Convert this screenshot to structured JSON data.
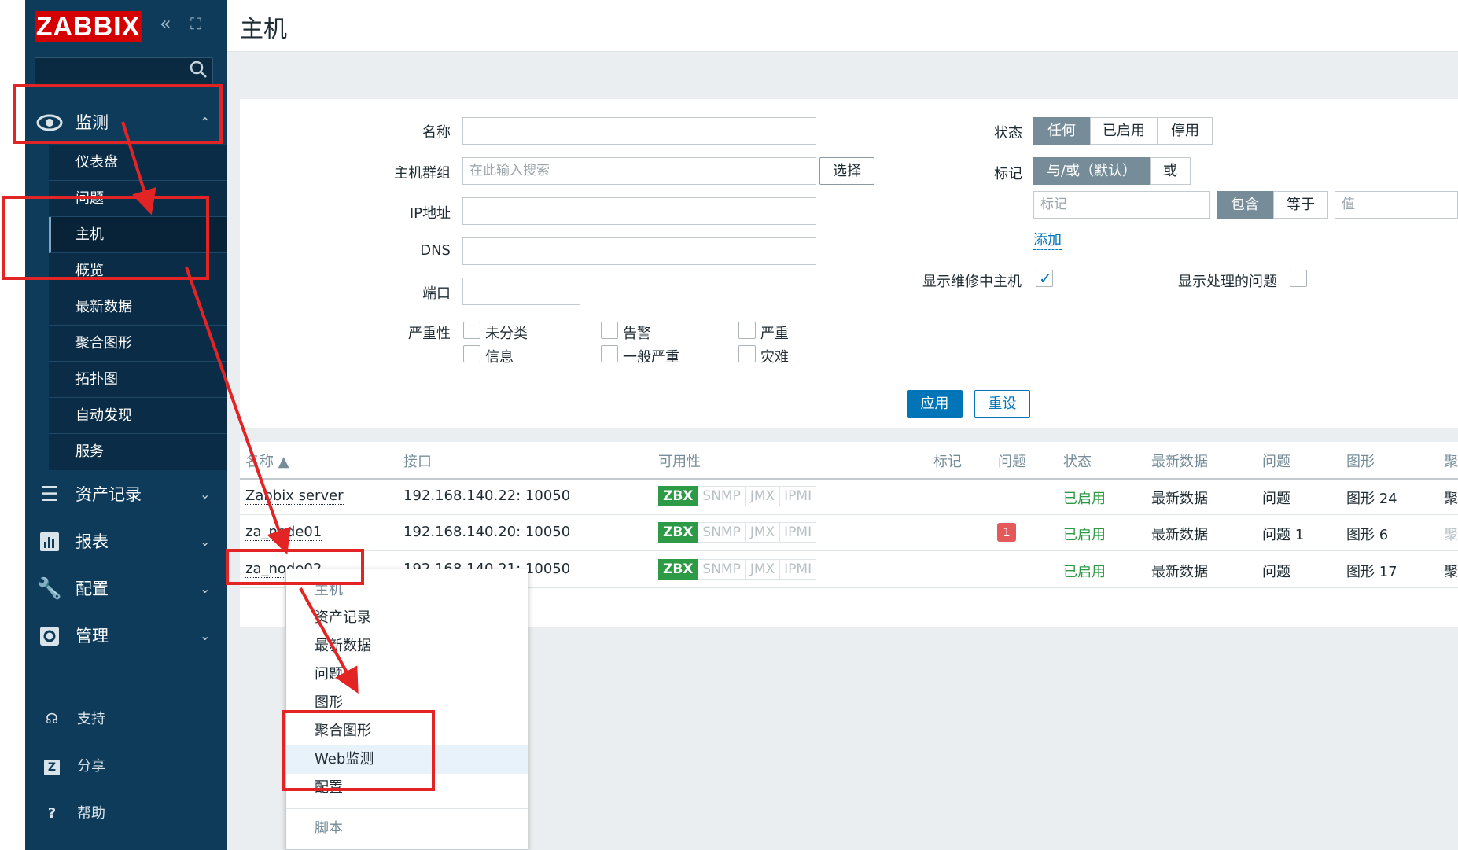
{
  "sidebar": {
    "logo": "ZABBIX",
    "collapse_icon": "«",
    "kiosk_icon": "⛶",
    "monitoring": {
      "label": "监测",
      "items": [
        "仪表盘",
        "问题",
        "主机",
        "概览",
        "最新数据",
        "聚合图形",
        "拓扑图",
        "自动发现",
        "服务"
      ]
    },
    "sections": [
      "资产记录",
      "报表",
      "配置",
      "管理"
    ],
    "footer": [
      "支持",
      "分享",
      "帮助"
    ]
  },
  "header": {
    "title": "主机"
  },
  "filter": {
    "name_label": "名称",
    "group_label": "主机群组",
    "group_placeholder": "在此输入搜索",
    "select_button": "选择",
    "ip_label": "IP地址",
    "dns_label": "DNS",
    "port_label": "端口",
    "severity_label": "严重性",
    "severities": [
      "未分类",
      "告警",
      "严重",
      "信息",
      "一般严重",
      "灾难"
    ],
    "status_label": "状态",
    "status_options": [
      "任何",
      "已启用",
      "停用"
    ],
    "tags_label": "标记",
    "tag_mode_options": [
      "与/或（默认）",
      "或"
    ],
    "tag_placeholder": "标记",
    "tag_op_options": [
      "包含",
      "等于"
    ],
    "value_placeholder": "值",
    "add_link": "添加",
    "show_maintenance_label": "显示维修中主机",
    "show_suppressed_label": "显示处理的问题",
    "apply_button": "应用",
    "reset_button": "重设"
  },
  "table": {
    "columns": [
      "名称 ▲",
      "接口",
      "可用性",
      "标记",
      "问题",
      "状态",
      "最新数据",
      "问题",
      "图形",
      "聚"
    ],
    "availability": [
      "ZBX",
      "SNMP",
      "JMX",
      "IPMI"
    ],
    "rows": [
      {
        "name": "Zabbix server",
        "interface": "192.168.140.22: 10050",
        "problems": "",
        "status": "已启用",
        "latest": "最新数据",
        "problems_link": "问题",
        "graphs": "图形 24",
        "screens": "聚"
      },
      {
        "name": "za_node01",
        "interface": "192.168.140.20: 10050",
        "problems": "1",
        "status": "已启用",
        "latest": "最新数据",
        "problems_link": "问题 1",
        "graphs": "图形 6",
        "screens": "聚"
      },
      {
        "name": "za_node02",
        "interface": "192.168.140.21: 10050",
        "problems": "",
        "status": "已启用",
        "latest": "最新数据",
        "problems_link": "问题",
        "graphs": "图形 17",
        "screens": "聚"
      }
    ]
  },
  "context_menu": {
    "header": "主机",
    "items": [
      "资产记录",
      "最新数据",
      "问题",
      "图形",
      "聚合图形",
      "Web监测",
      "配置"
    ],
    "scripts_header": "脚本"
  }
}
